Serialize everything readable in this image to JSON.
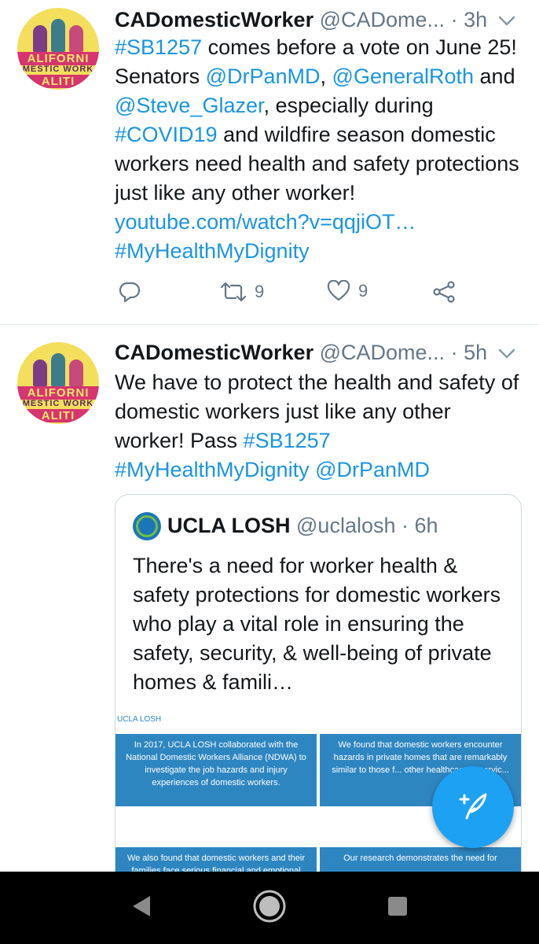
{
  "tweets": [
    {
      "name": "CADomesticWorker",
      "handle": "@CADome...",
      "sep": "·",
      "time": "3h",
      "text_parts": [
        {
          "t": "#SB1257",
          "link": true
        },
        {
          "t": " comes before a vote on June 25! Senators ",
          "link": false
        },
        {
          "t": "@DrPanMD",
          "link": true
        },
        {
          "t": ", ",
          "link": false
        },
        {
          "t": "@GeneralRoth",
          "link": true
        },
        {
          "t": " and ",
          "link": false
        },
        {
          "t": "@Steve_Glazer",
          "link": true
        },
        {
          "t": ", especially during ",
          "link": false
        },
        {
          "t": "#COVID19",
          "link": true
        },
        {
          "t": " and wildfire season domestic workers need health and safety protections just like any other worker! ",
          "link": false
        },
        {
          "t": "youtube.com/watch?v=qqjiOT…",
          "link": true
        },
        {
          "t": " ",
          "link": false
        },
        {
          "t": "#MyHealthMyDignity",
          "link": true
        }
      ],
      "retweets": "9",
      "likes": "9",
      "avatar_text": [
        "ALIFORNI",
        "MESTIC WORK",
        "ALITI"
      ]
    },
    {
      "name": "CADomesticWorker",
      "handle": "@CADome...",
      "sep": "·",
      "time": "5h",
      "text_parts": [
        {
          "t": "We have to protect the health and safety of domestic workers just like any other worker! Pass  ",
          "link": false
        },
        {
          "t": "#SB1257",
          "link": true
        },
        {
          "t": " ",
          "link": false
        },
        {
          "t": "#MyHealthMyDignity",
          "link": true
        },
        {
          "t": " ",
          "link": false
        },
        {
          "t": "@DrPanMD",
          "link": true
        }
      ],
      "avatar_text": [
        "ALIFORNI",
        "MESTIC WORK",
        "ALITI"
      ]
    }
  ],
  "quote": {
    "name": "UCLA LOSH",
    "handle": "@uclalosh",
    "sep": "·",
    "time": "6h",
    "text": "There's a need for worker health & safety protections for domestic workers who play a vital role in ensuring the safety, security, & well-being of private homes & famili…",
    "images": [
      {
        "header": "UCLA LOSH",
        "text": "In 2017, UCLA LOSH collaborated with the National Domestic Workers Alliance (NDWA) to investigate the job hazards and injury experiences of domestic workers."
      },
      {
        "header": "",
        "text": "We found that domestic workers encounter hazards in private homes that are remarkably similar to those f... other healthcare or servic..."
      },
      {
        "header": "",
        "text": "We also found that domestic workers and their families face serious financial and emotional"
      },
      {
        "header": "",
        "text": "Our research demonstrates the need for"
      }
    ]
  },
  "colors": {
    "link": "#1b95e0",
    "accent": "#1da1f2",
    "muted": "#657786"
  },
  "icons": [
    "reply-icon",
    "retweet-icon",
    "like-icon",
    "share-icon",
    "chevron-down-icon",
    "compose-icon",
    "nav-back-icon",
    "nav-home-icon",
    "nav-recents-icon"
  ]
}
